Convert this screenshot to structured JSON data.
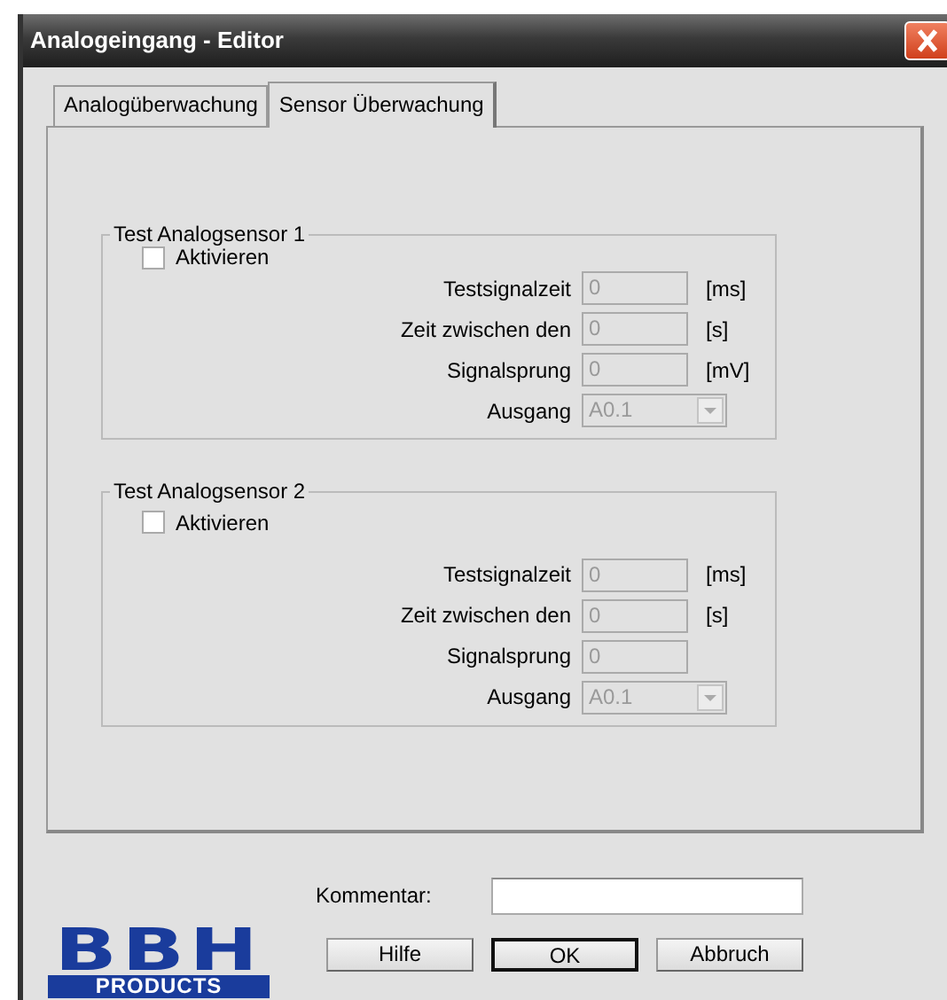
{
  "window": {
    "title": "Analogeingang - Editor"
  },
  "tabs": [
    {
      "label": "Analogüberwachung",
      "selected": false
    },
    {
      "label": "Sensor Überwachung",
      "selected": true
    }
  ],
  "groups": [
    {
      "title": "Test Analogsensor 1",
      "checkbox": {
        "label": "Aktivieren",
        "checked": false
      },
      "fields": [
        {
          "kind": "text",
          "label": "Testsignalzeit",
          "value": "0",
          "unit": "[ms]",
          "disabled": true
        },
        {
          "kind": "text",
          "label": "Zeit zwischen den",
          "value": "0",
          "unit": "[s]",
          "disabled": true
        },
        {
          "kind": "text",
          "label": "Signalsprung",
          "value": "0",
          "unit": "[mV]",
          "disabled": true
        },
        {
          "kind": "dropdown",
          "label": "Ausgang",
          "value": "A0.1",
          "disabled": true
        }
      ]
    },
    {
      "title": "Test Analogsensor 2",
      "checkbox": {
        "label": "Aktivieren",
        "checked": false
      },
      "fields": [
        {
          "kind": "text",
          "label": "Testsignalzeit",
          "value": "0",
          "unit": "[ms]",
          "disabled": true
        },
        {
          "kind": "text",
          "label": "Zeit zwischen den",
          "value": "0",
          "unit": "[s]",
          "disabled": true
        },
        {
          "kind": "text",
          "label": "Signalsprung",
          "value": "0",
          "disabled": true
        },
        {
          "kind": "dropdown",
          "label": "Ausgang",
          "value": "A0.1",
          "disabled": true
        }
      ]
    }
  ],
  "comment": {
    "label": "Kommentar:"
  },
  "logo": {
    "top": "BBH",
    "bottom": "PRODUCTS"
  },
  "buttons": [
    {
      "label": "Hilfe",
      "default": false
    },
    {
      "label": "OK",
      "default": true
    },
    {
      "label": "Abbruch",
      "default": false
    }
  ]
}
